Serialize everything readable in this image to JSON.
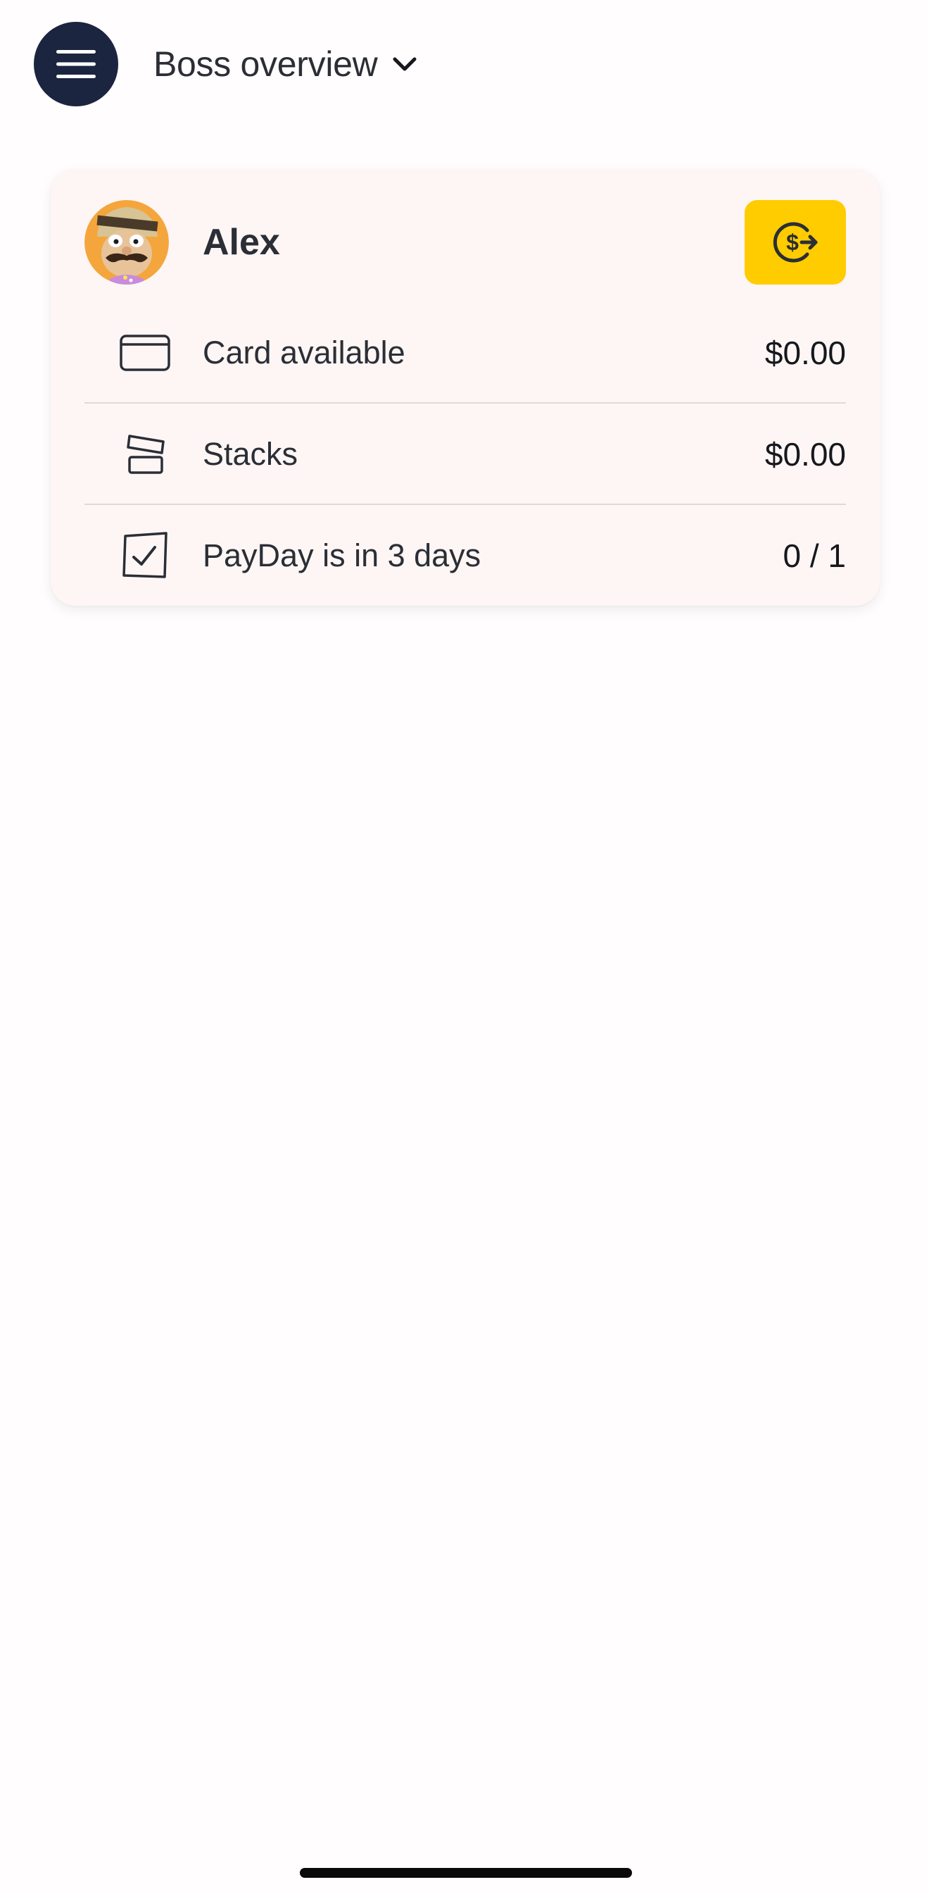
{
  "header": {
    "title": "Boss overview",
    "menu_icon": "hamburger-menu-icon",
    "dropdown_icon": "chevron-down-icon"
  },
  "child_card": {
    "name": "Alex",
    "avatar_icon": "mustache-character-avatar",
    "transfer_icon": "dollar-transfer-icon",
    "rows": [
      {
        "icon": "card-icon",
        "label": "Card available",
        "value": "$0.00"
      },
      {
        "icon": "stacks-icon",
        "label": "Stacks",
        "value": "$0.00"
      },
      {
        "icon": "checkbox-icon",
        "label": "PayDay is in 3 days",
        "value": "0 / 1"
      }
    ]
  },
  "colors": {
    "background": "#fffdfd",
    "menu_button": "#1b2540",
    "card_background": "#fdf6f5",
    "accent_yellow": "#ffcc00",
    "text": "#2b2e36"
  }
}
